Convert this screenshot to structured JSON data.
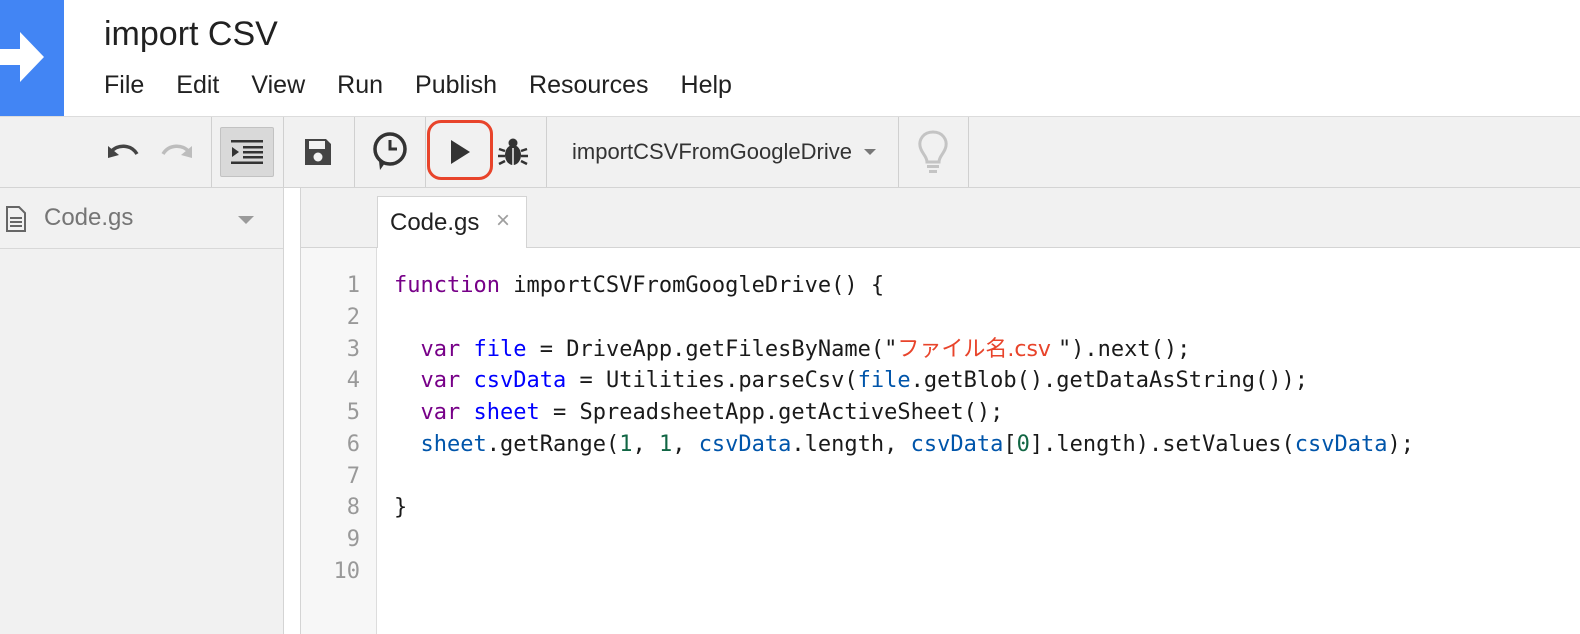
{
  "header": {
    "title": "import CSV",
    "menu": [
      "File",
      "Edit",
      "View",
      "Run",
      "Publish",
      "Resources",
      "Help"
    ]
  },
  "toolbar": {
    "function_select": "importCSVFromGoogleDrive"
  },
  "sidebar": {
    "file": "Code.gs"
  },
  "editor": {
    "tab_label": "Code.gs",
    "tab_close": "×",
    "line_numbers": [
      "1",
      "2",
      "3",
      "4",
      "5",
      "6",
      "7",
      "8",
      "9",
      "10"
    ],
    "code": {
      "l1_kw": "function",
      "l1_rest": " importCSVFromGoogleDrive() {",
      "l3_var": "var",
      "l3_name": "file",
      "l3_mid": " = DriveApp.getFilesByName(\"",
      "l3_str": "ファイル名.csv ",
      "l3_end": "\").next();",
      "l4_var": "var",
      "l4_name": "csvData",
      "l4_mid": " = Utilities.parseCsv(",
      "l4_ref": "file",
      "l4_end": ".getBlob().getDataAsString());",
      "l5_var": "var",
      "l5_name": "sheet",
      "l5_end": " = SpreadsheetApp.getActiveSheet();",
      "l6_ref1": "sheet",
      "l6_a": ".getRange(",
      "l6_n1": "1",
      "l6_b": ", ",
      "l6_n2": "1",
      "l6_c": ", ",
      "l6_ref2": "csvData",
      "l6_d": ".length, ",
      "l6_ref3": "csvData",
      "l6_e": "[",
      "l6_n3": "0",
      "l6_f": "].length).setValues(",
      "l6_ref4": "csvData",
      "l6_g": ");",
      "l8": "}"
    }
  },
  "colors": {
    "brand_blue": "#4285f4",
    "run_highlight": "#e8442b",
    "keyword": "#770088",
    "def": "#0000ff",
    "variable": "#0055aa",
    "number": "#116644",
    "string": "#e8442b"
  },
  "icons": [
    "arrow-right-icon",
    "undo-icon",
    "redo-icon",
    "indent-icon",
    "save-icon",
    "clock-icon",
    "play-icon",
    "bug-icon",
    "lightbulb-icon",
    "file-icon"
  ]
}
